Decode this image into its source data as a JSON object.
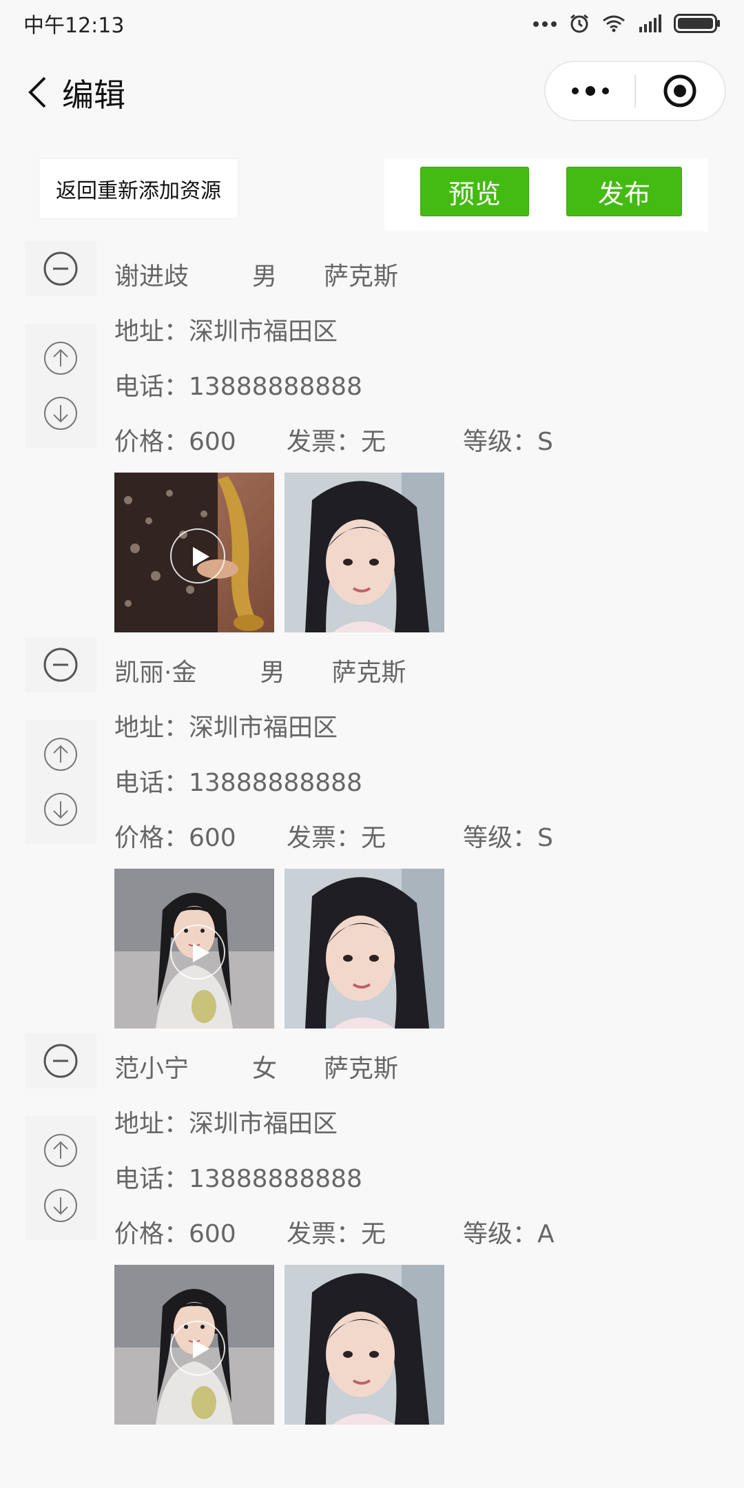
{
  "status_bar": {
    "time": "中午12:13",
    "icons": [
      "more-dots-icon",
      "alarm-icon",
      "wifi-icon",
      "signal-icon",
      "battery-icon"
    ]
  },
  "nav": {
    "title": "编辑",
    "icons": [
      "back-chevron-icon",
      "more-dots-icon",
      "target-circle-icon"
    ]
  },
  "toolbar": {
    "back_add_label": "返回重新添加资源",
    "preview_label": "预览",
    "publish_label": "发布"
  },
  "colors": {
    "accent_green": "#44bb12",
    "background": "#f8f8f8",
    "text_gray": "#666666"
  },
  "records": [
    {
      "name": "谢进歧",
      "gender": "男",
      "instrument": "萨克斯",
      "address": "地址：深圳市福田区",
      "phone": "电话：13888888888",
      "price": "价格：600",
      "invoice": "发票：无",
      "level": "等级：S",
      "media": [
        {
          "kind": "video",
          "icon": "play-icon",
          "subject": "saxophone-player-photo"
        },
        {
          "kind": "image",
          "subject": "portrait-photo"
        }
      ]
    },
    {
      "name": "凯丽·金",
      "gender": "男",
      "instrument": "萨克斯",
      "address": "地址：深圳市福田区",
      "phone": "电话：13888888888",
      "price": "价格：600",
      "invoice": "发票：无",
      "level": "等级：S",
      "media": [
        {
          "kind": "video",
          "icon": "play-icon",
          "subject": "costume-portrait-photo"
        },
        {
          "kind": "image",
          "subject": "portrait-photo"
        }
      ]
    },
    {
      "name": "范小宁",
      "gender": "女",
      "instrument": "萨克斯",
      "address": "地址：深圳市福田区",
      "phone": "电话：13888888888",
      "price": "价格：600",
      "invoice": "发票：无",
      "level": "等级：A",
      "media": [
        {
          "kind": "video",
          "icon": "play-icon",
          "subject": "costume-portrait-photo"
        },
        {
          "kind": "image",
          "subject": "portrait-photo"
        }
      ]
    }
  ]
}
